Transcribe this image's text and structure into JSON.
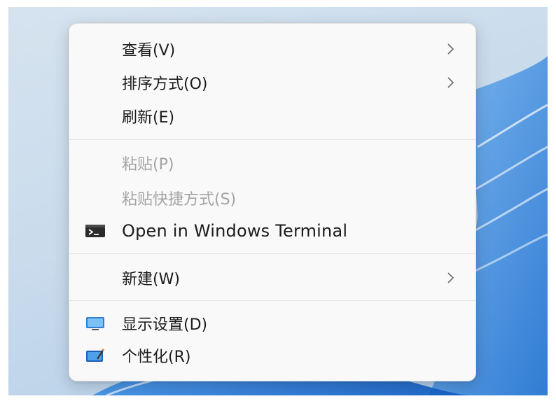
{
  "context_menu": {
    "items": [
      {
        "label": "查看(V)",
        "has_submenu": true,
        "enabled": true
      },
      {
        "label": "排序方式(O)",
        "has_submenu": true,
        "enabled": true
      },
      {
        "label": "刷新(E)",
        "has_submenu": false,
        "enabled": true
      },
      {
        "label": "粘贴(P)",
        "has_submenu": false,
        "enabled": false
      },
      {
        "label": "粘贴快捷方式(S)",
        "has_submenu": false,
        "enabled": false
      },
      {
        "label": "Open in Windows Terminal",
        "icon": "terminal-icon",
        "has_submenu": false,
        "enabled": true
      },
      {
        "label": "新建(W)",
        "has_submenu": true,
        "enabled": true
      },
      {
        "label": "显示设置(D)",
        "icon": "display-settings-icon",
        "has_submenu": false,
        "enabled": true
      },
      {
        "label": "个性化(R)",
        "icon": "personalize-icon",
        "has_submenu": false,
        "enabled": true
      }
    ]
  },
  "colors": {
    "menu_background": "#f9f9f9",
    "text": "#1c1c1c",
    "disabled_text": "#a3a3a3",
    "separator": "#e5e5e5",
    "icon_blue": "#2b7fd6"
  }
}
